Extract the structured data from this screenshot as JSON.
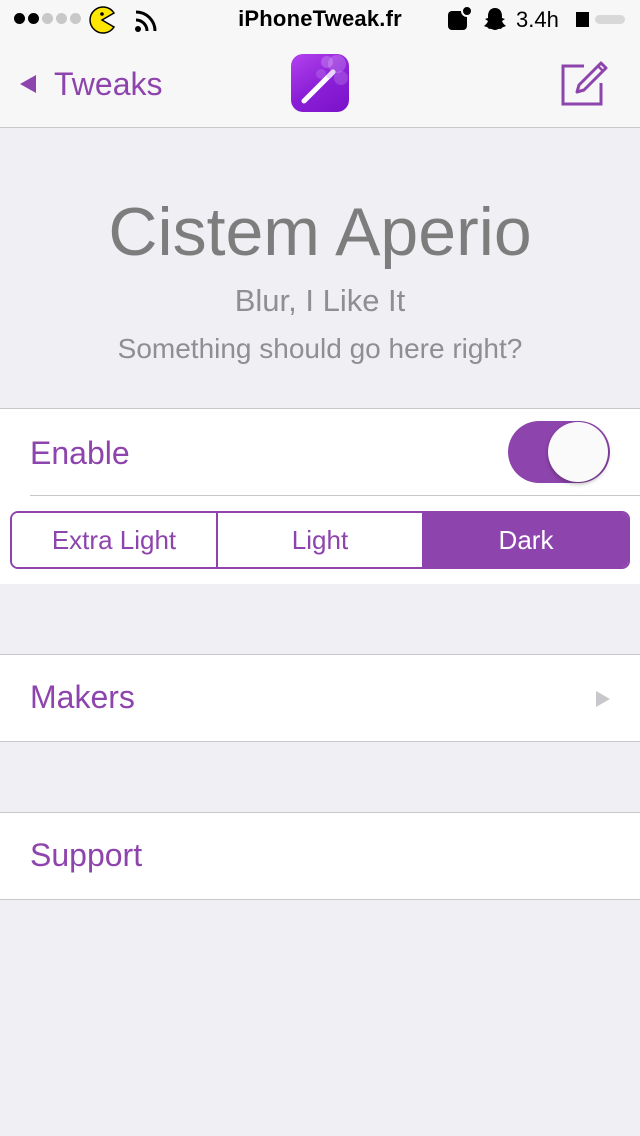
{
  "status_bar": {
    "carrier": "iPhoneTweak.fr",
    "time": "3.4h",
    "icons": [
      "signal-dots",
      "pacman-icon",
      "wifi-icon",
      "notification-icon",
      "snapchat-ghost-icon",
      "lock-square-icon",
      "battery-icon"
    ]
  },
  "nav": {
    "back_label": "Tweaks",
    "icon": "magic-wand-icon",
    "right_icon": "compose-icon"
  },
  "header": {
    "title": "Cistem Aperio",
    "subtitle": "Blur, I Like It",
    "note": "Something should go here right?"
  },
  "enable": {
    "label": "Enable",
    "on": true
  },
  "blur_style": {
    "options": [
      "Extra Light",
      "Light",
      "Dark"
    ],
    "selected": "Dark"
  },
  "rows": {
    "makers": "Makers",
    "support": "Support"
  },
  "colors": {
    "accent": "#8e44ad",
    "background": "#efeff4",
    "bar": "#f7f7f7"
  }
}
